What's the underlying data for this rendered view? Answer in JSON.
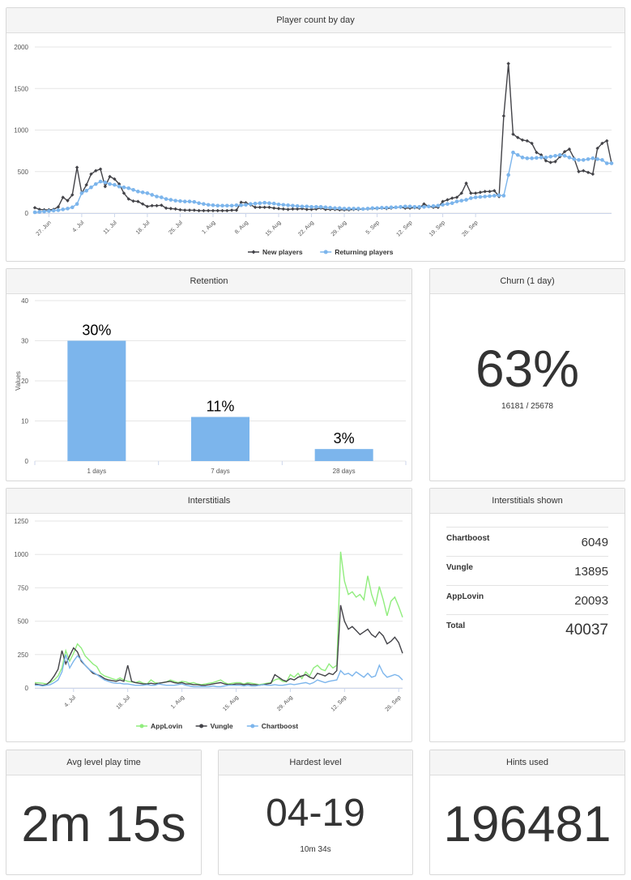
{
  "colors": {
    "new_players": "#434348",
    "returning": "#7cb5ec",
    "applovin": "#90ed7d",
    "vungle": "#434348",
    "chartboost": "#7cb5ec",
    "bar": "#7cb5ec",
    "grid": "#e6e6e6"
  },
  "panels": {
    "player_count": {
      "title": "Player count by day"
    },
    "retention": {
      "title": "Retention"
    },
    "churn": {
      "title": "Churn (1 day)",
      "value": "63%",
      "sub": "16181 / 25678"
    },
    "interstitials": {
      "title": "Interstitials"
    },
    "interstitials_shown": {
      "title": "Interstitials shown",
      "rows": [
        {
          "label": "Chartboost",
          "value": "6049"
        },
        {
          "label": "Vungle",
          "value": "13895"
        },
        {
          "label": "AppLovin",
          "value": "20093"
        },
        {
          "label": "Total",
          "value": "40037"
        }
      ]
    },
    "avg_play_time": {
      "title": "Avg level play time",
      "value": "2m 15s"
    },
    "hardest_level": {
      "title": "Hardest level",
      "value": "04-19",
      "sub": "10m 34s"
    },
    "hints_used": {
      "title": "Hints used",
      "value": "196481"
    }
  },
  "chart_data": [
    {
      "type": "line",
      "x_start": "2016-06-24",
      "xtick_labels": [
        "27. Jun",
        "4. Jul",
        "11. Jul",
        "18. Jul",
        "25. Jul",
        "1. Aug",
        "8. Aug",
        "15. Aug",
        "22. Aug",
        "29. Aug",
        "5. Sep",
        "12. Sep",
        "19. Sep",
        "26. Sep"
      ],
      "xtick_days": [
        3,
        10,
        17,
        24,
        31,
        38,
        45,
        52,
        59,
        66,
        73,
        80,
        87,
        94
      ],
      "ylim": [
        0,
        2000
      ],
      "yticks": [
        0,
        500,
        1000,
        1500,
        2000
      ],
      "legend": "bottom-center",
      "grid": true,
      "series": [
        {
          "name": "New players",
          "marker": "diamond",
          "values": [
            65,
            45,
            40,
            40,
            45,
            75,
            190,
            150,
            220,
            550,
            240,
            340,
            470,
            510,
            530,
            320,
            440,
            410,
            350,
            240,
            170,
            145,
            140,
            110,
            80,
            90,
            90,
            95,
            60,
            55,
            50,
            40,
            35,
            35,
            35,
            30,
            30,
            30,
            30,
            30,
            30,
            30,
            35,
            35,
            130,
            125,
            100,
            70,
            70,
            70,
            70,
            60,
            55,
            50,
            45,
            50,
            50,
            55,
            45,
            45,
            50,
            60,
            45,
            45,
            45,
            40,
            40,
            40,
            45,
            45,
            50,
            50,
            55,
            55,
            60,
            55,
            60,
            70,
            70,
            60,
            60,
            65,
            60,
            110,
            80,
            70,
            70,
            140,
            160,
            180,
            190,
            240,
            360,
            240,
            240,
            250,
            260,
            260,
            270,
            200,
            1170,
            1800,
            950,
            910,
            880,
            870,
            840,
            730,
            700,
            630,
            610,
            620,
            680,
            740,
            770,
            660,
            500,
            510,
            490,
            470,
            780,
            840,
            870,
            600
          ]
        },
        {
          "name": "Returning players",
          "marker": "circle",
          "values": [
            10,
            15,
            20,
            25,
            30,
            35,
            45,
            55,
            70,
            110,
            240,
            270,
            310,
            350,
            380,
            370,
            350,
            340,
            320,
            310,
            300,
            280,
            260,
            250,
            240,
            220,
            200,
            190,
            170,
            160,
            150,
            145,
            140,
            140,
            135,
            120,
            110,
            100,
            95,
            90,
            90,
            90,
            90,
            95,
            95,
            100,
            110,
            115,
            120,
            125,
            120,
            115,
            105,
            100,
            95,
            90,
            85,
            80,
            80,
            75,
            75,
            75,
            70,
            65,
            60,
            60,
            55,
            55,
            55,
            55,
            50,
            55,
            60,
            60,
            65,
            65,
            70,
            70,
            75,
            80,
            80,
            75,
            75,
            75,
            80,
            85,
            90,
            100,
            110,
            120,
            140,
            150,
            160,
            180,
            190,
            195,
            200,
            205,
            210,
            215,
            210,
            460,
            730,
            700,
            670,
            660,
            660,
            665,
            670,
            670,
            680,
            690,
            700,
            690,
            670,
            650,
            640,
            640,
            650,
            660,
            650,
            640,
            600,
            600
          ]
        }
      ]
    },
    {
      "type": "bar",
      "categories": [
        "1 days",
        "7 days",
        "28 days"
      ],
      "values": [
        30,
        11,
        3
      ],
      "data_labels": [
        "30%",
        "11%",
        "3%"
      ],
      "ylabel": "Values",
      "ylim": [
        0,
        40
      ],
      "yticks": [
        0,
        10,
        20,
        30,
        40
      ],
      "grid": true
    },
    {
      "type": "line",
      "xtick_labels": [
        "4. Jul",
        "18. Jul",
        "1. Aug",
        "15. Aug",
        "29. Aug",
        "12. Sep",
        "26. Sep"
      ],
      "xtick_days": [
        10,
        24,
        38,
        52,
        66,
        80,
        94
      ],
      "ylim": [
        0,
        1250
      ],
      "yticks": [
        0,
        250,
        500,
        750,
        1000,
        1250
      ],
      "legend": "bottom-center",
      "grid": true,
      "series": [
        {
          "name": "AppLovin",
          "values": [
            40,
            38,
            35,
            30,
            40,
            60,
            90,
            150,
            280,
            200,
            260,
            330,
            300,
            240,
            210,
            180,
            160,
            110,
            90,
            80,
            70,
            60,
            75,
            60,
            50,
            45,
            40,
            50,
            35,
            30,
            60,
            40,
            35,
            40,
            45,
            60,
            50,
            40,
            50,
            45,
            35,
            40,
            30,
            25,
            30,
            35,
            40,
            50,
            60,
            40,
            30,
            35,
            40,
            40,
            30,
            40,
            35,
            30,
            25,
            30,
            35,
            40,
            60,
            70,
            50,
            45,
            100,
            80,
            110,
            70,
            120,
            90,
            150,
            170,
            140,
            130,
            180,
            150,
            170,
            1020,
            800,
            700,
            720,
            680,
            700,
            660,
            840,
            700,
            620,
            760,
            660,
            540,
            650,
            680,
            610,
            530
          ]
        },
        {
          "name": "Vungle",
          "values": [
            30,
            25,
            20,
            25,
            50,
            90,
            140,
            280,
            180,
            240,
            300,
            270,
            200,
            170,
            140,
            110,
            100,
            90,
            70,
            60,
            55,
            50,
            60,
            50,
            170,
            50,
            40,
            35,
            30,
            30,
            35,
            30,
            35,
            40,
            45,
            50,
            40,
            35,
            40,
            30,
            30,
            25,
            25,
            20,
            20,
            25,
            30,
            35,
            40,
            30,
            25,
            25,
            30,
            30,
            25,
            30,
            25,
            25,
            20,
            25,
            30,
            35,
            100,
            80,
            60,
            50,
            70,
            60,
            80,
            90,
            100,
            80,
            70,
            110,
            100,
            90,
            110,
            100,
            130,
            620,
            500,
            440,
            460,
            430,
            400,
            420,
            440,
            400,
            380,
            420,
            390,
            330,
            350,
            380,
            340,
            260
          ]
        },
        {
          "name": "Chartboost",
          "values": [
            20,
            20,
            15,
            20,
            25,
            40,
            60,
            120,
            250,
            150,
            200,
            240,
            210,
            170,
            140,
            120,
            100,
            80,
            60,
            50,
            40,
            35,
            35,
            30,
            30,
            25,
            20,
            20,
            20,
            25,
            20,
            20,
            30,
            25,
            20,
            20,
            20,
            25,
            30,
            20,
            15,
            10,
            10,
            10,
            10,
            10,
            15,
            10,
            10,
            15,
            20,
            20,
            20,
            20,
            15,
            20,
            15,
            15,
            20,
            25,
            20,
            20,
            25,
            20,
            20,
            25,
            30,
            25,
            30,
            35,
            40,
            30,
            40,
            60,
            50,
            40,
            50,
            55,
            60,
            130,
            100,
            110,
            90,
            120,
            100,
            80,
            110,
            80,
            90,
            170,
            110,
            80,
            90,
            100,
            90,
            60
          ]
        }
      ]
    }
  ]
}
